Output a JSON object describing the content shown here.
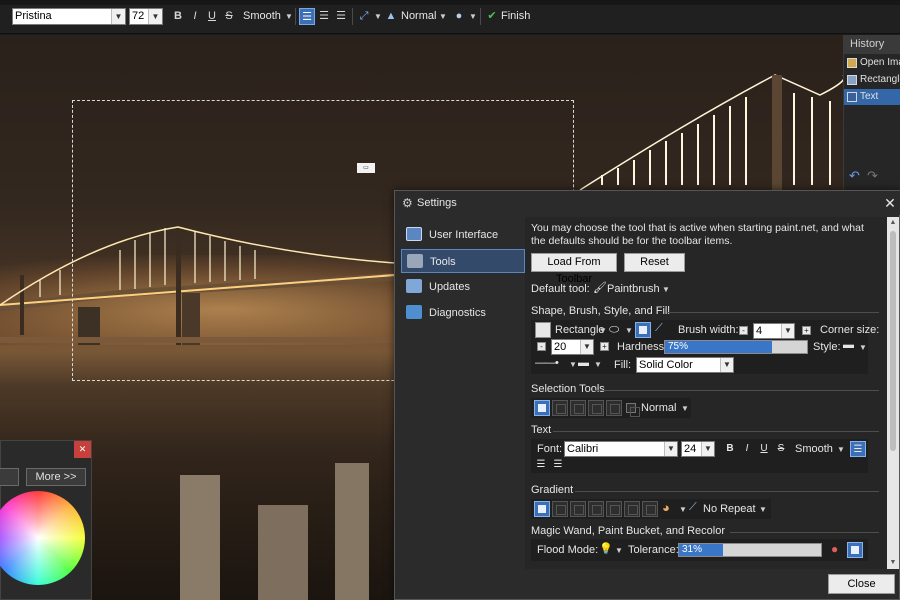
{
  "toolbar": {
    "font_name": "Pristina",
    "font_size": "72",
    "bold": "B",
    "italic": "I",
    "underline": "U",
    "strike": "S",
    "smoothing": "Smooth",
    "blend_mode": "Normal",
    "finish_label": "Finish"
  },
  "history": {
    "title": "History",
    "items": [
      "Open Image",
      "Rectangle Select",
      "Text"
    ]
  },
  "palette": {
    "more_label": "More >>"
  },
  "settings": {
    "title": "Settings",
    "nav": [
      "User Interface",
      "Tools",
      "Updates",
      "Diagnostics"
    ],
    "intro": "You may choose the tool that is active when starting paint.net, and what the defaults should be for the toolbar items.",
    "load_button": "Load From Toolbar",
    "reset_button": "Reset",
    "default_tool_label": "Default tool:",
    "default_tool_value": "Paintbrush",
    "section_shape": "Shape, Brush, Style, and Fill",
    "shape_value": "Rectangle",
    "brush_width_label": "Brush width:",
    "brush_width_value": "4",
    "corner_size_label": "Corner size:",
    "corner_size_value": "20",
    "hardness_label": "Hardness:",
    "hardness_value": "75%",
    "hardness_fraction": 0.75,
    "style_label": "Style:",
    "fill_label": "Fill:",
    "fill_value": "Solid Color",
    "section_selection": "Selection Tools",
    "selection_mode": "Normal",
    "section_text": "Text",
    "font_label": "Font:",
    "font_value": "Calibri",
    "font_size_value": "24",
    "text_smoothing": "Smooth",
    "section_gradient": "Gradient",
    "gradient_repeat": "No Repeat",
    "section_magic": "Magic Wand, Paint Bucket, and Recolor",
    "flood_mode_label": "Flood Mode:",
    "tolerance_label": "Tolerance:",
    "tolerance_value": "31%",
    "tolerance_fraction": 0.31,
    "close_button": "Close"
  },
  "colors": {
    "accent": "#3b6fb6",
    "dialog_bg": "#2b2b2b",
    "history_selected": "#3467a8",
    "palette_close": "#c8403b"
  }
}
